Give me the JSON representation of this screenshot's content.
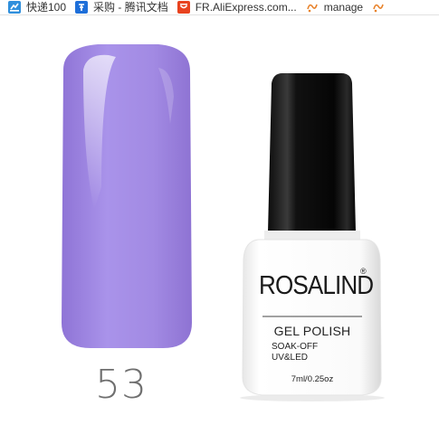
{
  "bookmarks": [
    {
      "label": "快递100",
      "icon": "kuaidi100-icon",
      "color": "#2f8fdc"
    },
    {
      "label": "采购 - 腾讯文档",
      "icon": "tencent-docs-icon",
      "color": "#1e6fd9"
    },
    {
      "label": "FR.AliExpress.com...",
      "icon": "aliexpress-icon",
      "color": "#e8431f"
    },
    {
      "label": "manage",
      "icon": "manage-icon",
      "color": "#e8822a"
    },
    {
      "label": "",
      "icon": "manage-icon",
      "color": "#e8822a"
    }
  ],
  "product": {
    "shade_number": "53",
    "nail_color": "#a58be4",
    "brand": "ROSALIND",
    "registered_mark": "®",
    "product_type": "GEL POLISH",
    "features": [
      "SOAK-OFF",
      "UV&LED"
    ],
    "volume": "7ml/0.25oz"
  }
}
